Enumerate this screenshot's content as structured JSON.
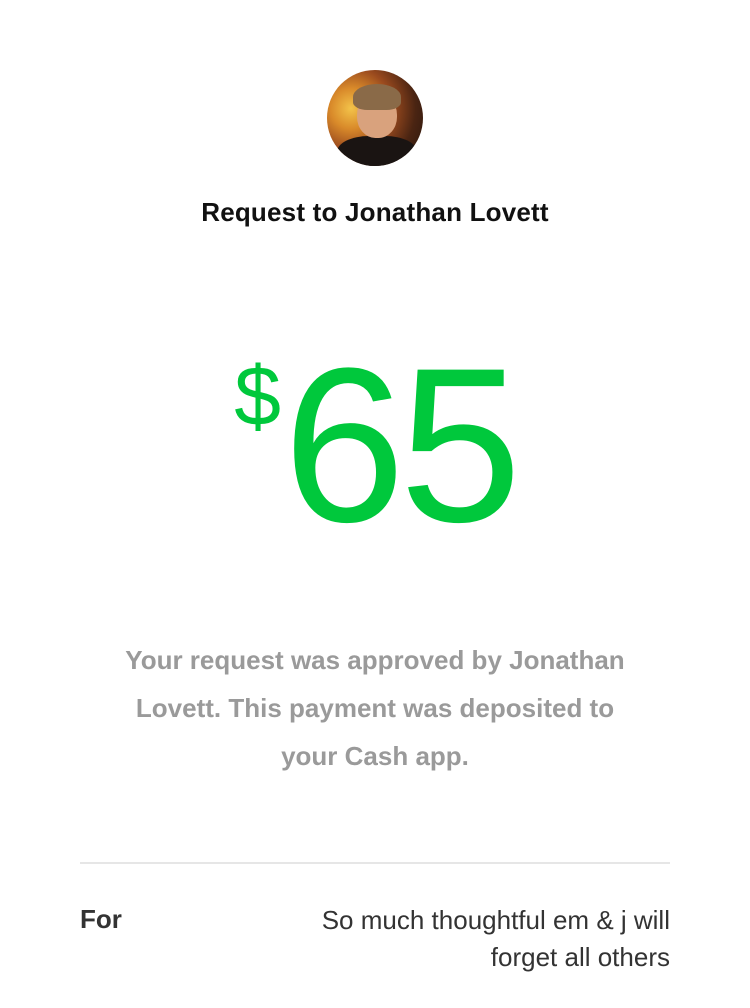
{
  "request": {
    "title": "Request to Jonathan Lovett",
    "currency_symbol": "$",
    "amount": "65",
    "message": "Your request was approved by Jonathan Lovett. This payment was deposited to your Cash app.",
    "accent_color": "#00c83c"
  },
  "details": {
    "for_label": "For",
    "for_value": "So much thoughtful em & j will forget all others"
  }
}
